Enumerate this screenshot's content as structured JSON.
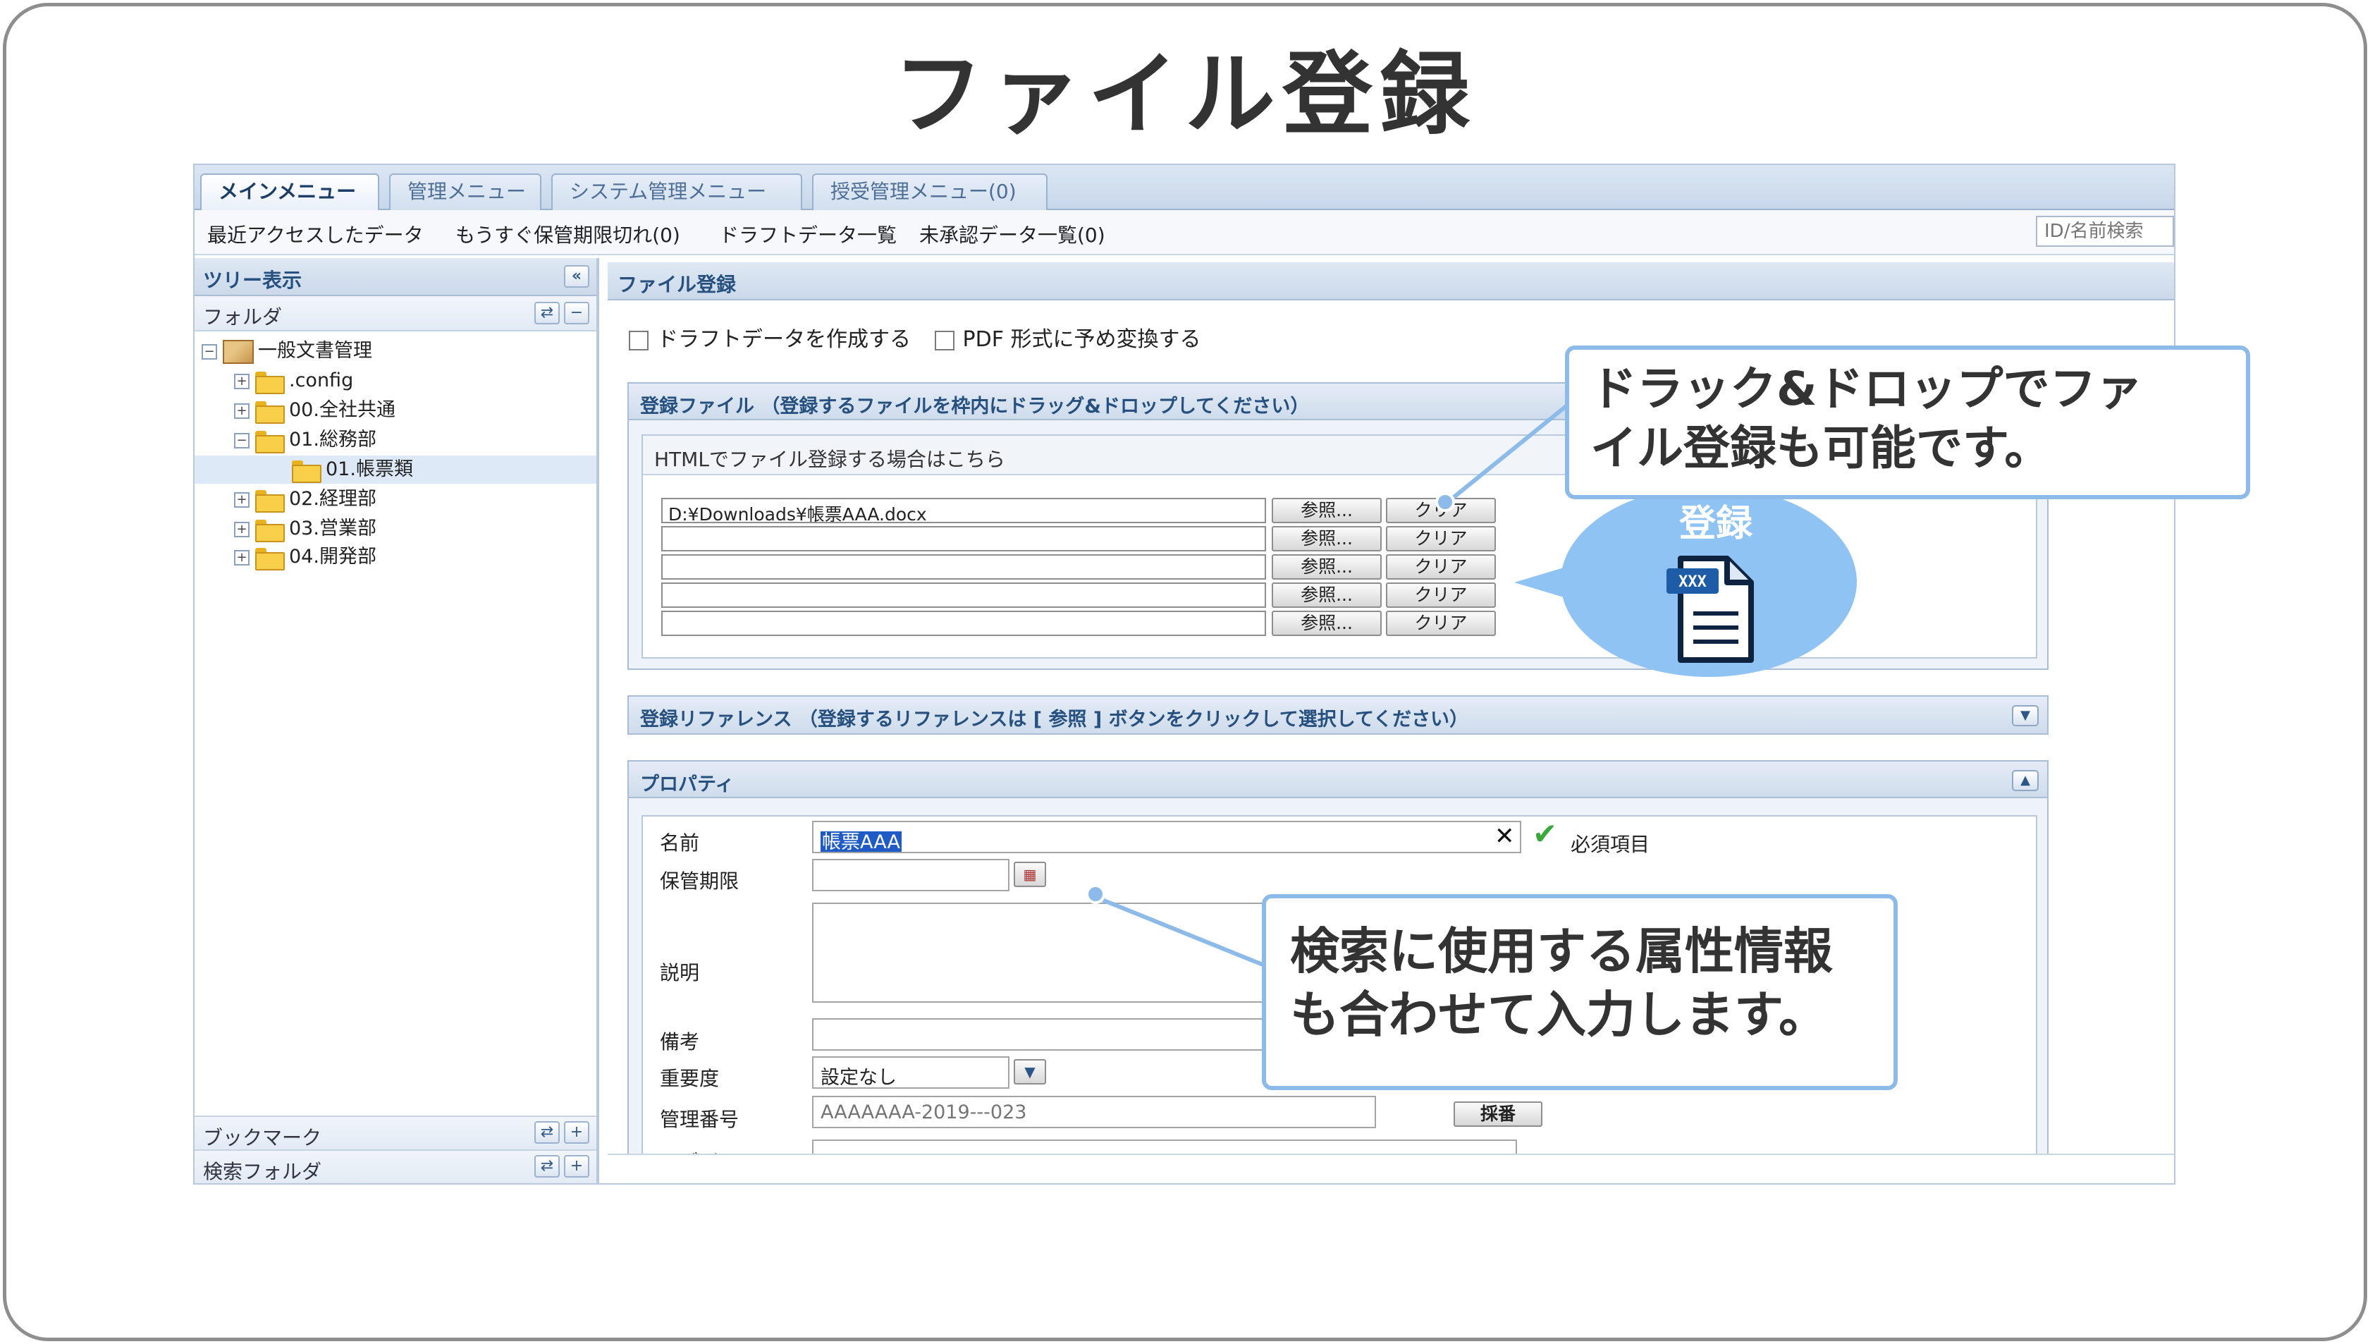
{
  "slide": {
    "title": "ファイル登録"
  },
  "tabs": [
    {
      "label": "メインメニュー"
    },
    {
      "label": "管理メニュー"
    },
    {
      "label": "システム管理メニュー"
    },
    {
      "label": "授受管理メニュー(0)"
    }
  ],
  "toolbar": {
    "links": [
      {
        "label": "最近アクセスしたデータ"
      },
      {
        "label": "もうすぐ保管期限切れ(0)"
      },
      {
        "label": "ドラフトデータ一覧"
      },
      {
        "label": "未承認データ一覧(0)"
      }
    ],
    "search_placeholder": "ID/名前検索"
  },
  "tree": {
    "header": "ツリー表示",
    "folder_label": "フォルダ",
    "root": "一般文書管理",
    "items": [
      {
        "label": ".config"
      },
      {
        "label": "00.全社共通"
      },
      {
        "label": "01.総務部"
      },
      {
        "label": "01.帳票類"
      },
      {
        "label": "02.経理部"
      },
      {
        "label": "03.営業部"
      },
      {
        "label": "04.開発部"
      }
    ],
    "bookmark_label": "ブックマーク",
    "search_folder_label": "検索フォルダ"
  },
  "main": {
    "header": "ファイル登録",
    "options": {
      "draft_label": "ドラフトデータを作成する",
      "pdf_label": "PDF 形式に予め変換する"
    },
    "upload_section": {
      "title": "登録ファイル （登録するファイルを枠内にドラッグ&ドロップしてください）",
      "html_link": "HTMLでファイル登録する場合はこちら",
      "files": [
        {
          "value": "D:¥Downloads¥帳票AAA.docx"
        },
        {
          "value": ""
        },
        {
          "value": ""
        },
        {
          "value": ""
        },
        {
          "value": ""
        }
      ],
      "browse_label": "参照...",
      "clear_label": "クリア"
    },
    "reference_section": {
      "title": "登録リファレンス （登録するリファレンスは [ 参照 ] ボタンをクリックして選択してください）"
    },
    "property_section": {
      "title": "プロパティ",
      "name_label": "名前",
      "name_value": "帳票AAA",
      "required_label": "必須項目",
      "retention_label": "保管期限",
      "description_label": "説明",
      "remarks_label": "備考",
      "importance_label": "重要度",
      "importance_value": "設定なし",
      "number_label": "管理番号",
      "number_placeholder": "AAAAAAA-2019---023",
      "number_button": "採番",
      "revision_label": "リビジョン"
    }
  },
  "callouts": {
    "drag_drop": "ドラック&ドロップでファ\nイル登録も可能です。",
    "attributes": "検索に使用する属性情報\nも合わせて入力します。",
    "drop_target_label": "登録",
    "doc_icon_text": "XXX"
  },
  "colors": {
    "accent": "#8dbbe9",
    "header_text": "#26507f",
    "selection": "#1e5bc6"
  }
}
